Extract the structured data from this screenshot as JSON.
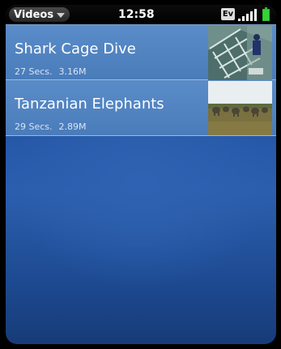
{
  "statusbar": {
    "app_menu_label": "Videos",
    "time": "12:58",
    "network_badge": "Ev",
    "signal_icon": "signal-bars-icon",
    "battery_icon": "battery-icon",
    "battery_color": "#36d136"
  },
  "videos": [
    {
      "title": "Shark Cage Dive",
      "duration": "27 Secs.",
      "size": "3.16M",
      "thumbnail_icon": "shark-cage-thumbnail"
    },
    {
      "title": "Tanzanian Elephants",
      "duration": "29 Secs.",
      "size": "2.89M",
      "thumbnail_icon": "elephants-thumbnail"
    }
  ],
  "colors": {
    "background": "#2456a6",
    "row": "#5a8cc9",
    "text": "#ffffff"
  }
}
